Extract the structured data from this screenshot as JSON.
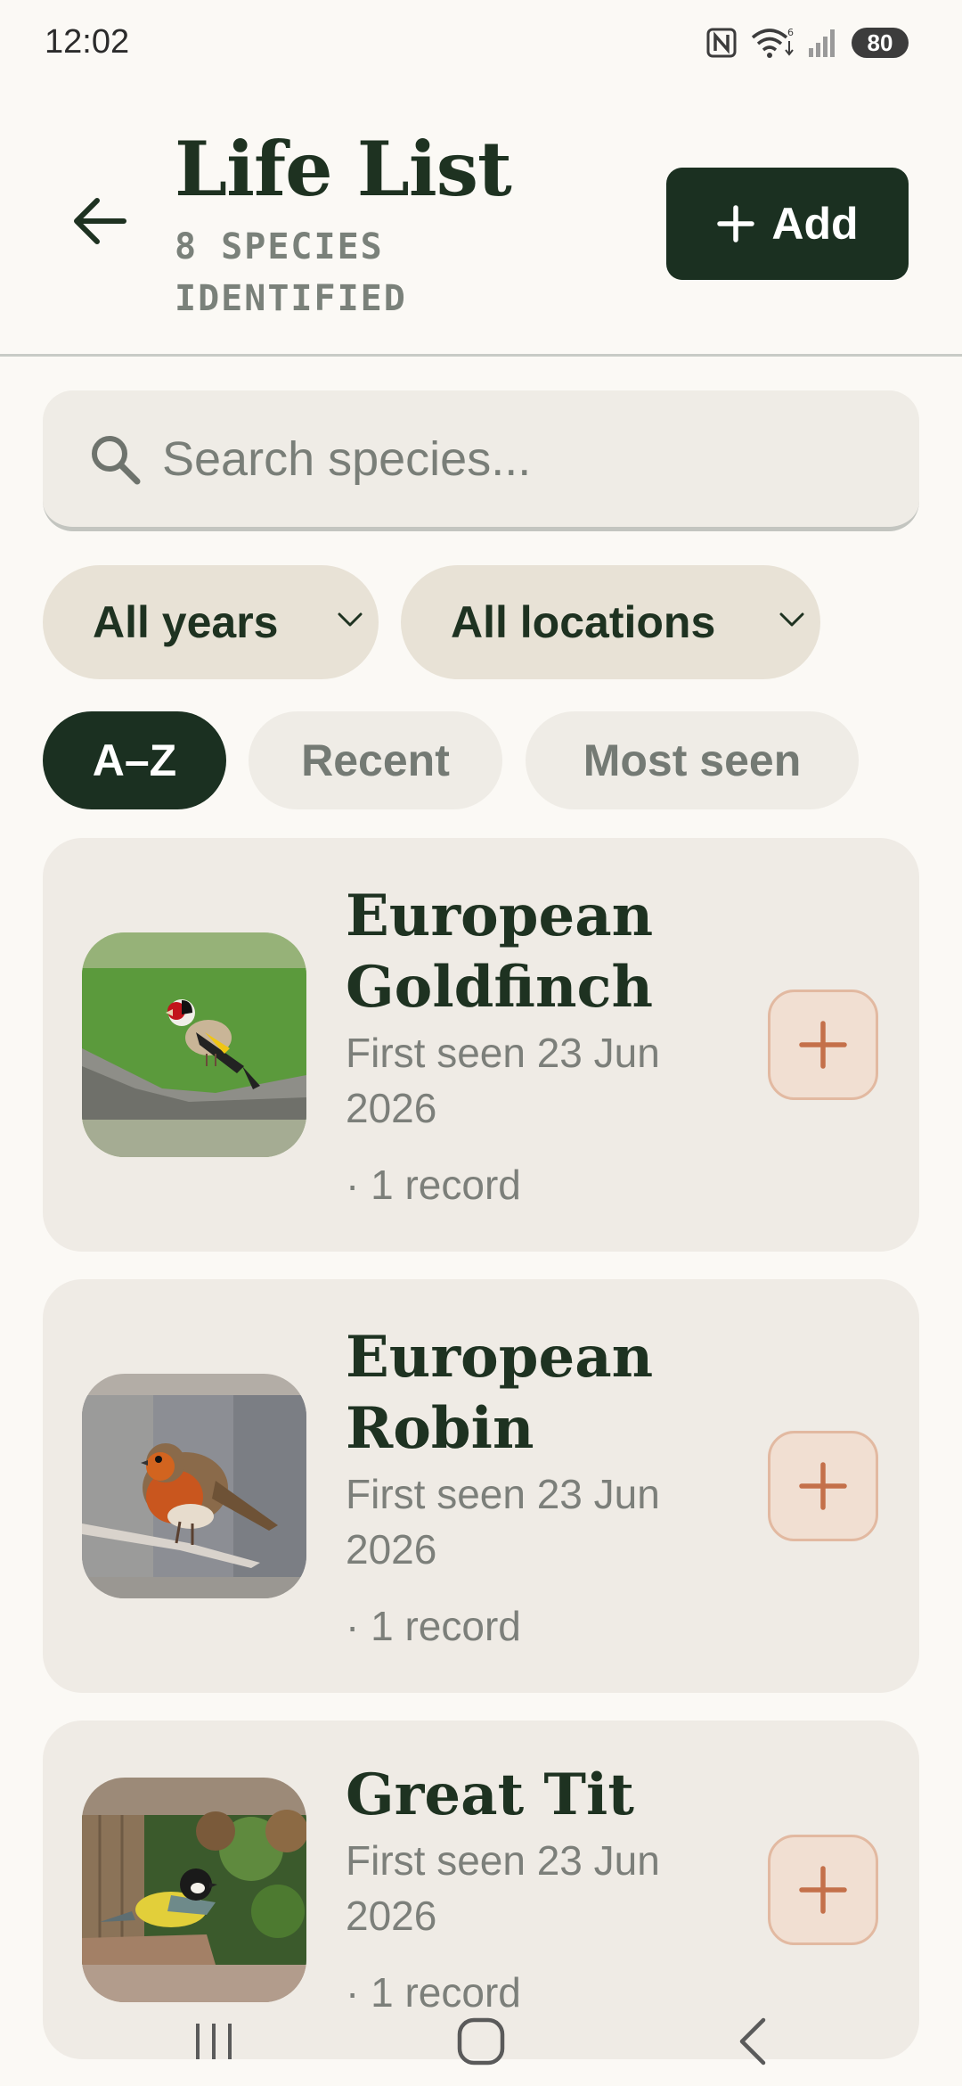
{
  "status_bar": {
    "time": "12:02",
    "battery": "80",
    "icons": [
      "nfc-icon",
      "wifi-icon",
      "signal-icon",
      "battery-icon"
    ]
  },
  "header": {
    "title": "Life List",
    "subtitle": "8 SPECIES IDENTIFIED",
    "add_label": "Add"
  },
  "search": {
    "placeholder": "Search species..."
  },
  "filters": {
    "years": "All years",
    "locations": "All locations"
  },
  "sort": {
    "options": [
      "A–Z",
      "Recent",
      "Most seen"
    ],
    "active": "A–Z"
  },
  "species": [
    {
      "name": "European Goldfinch",
      "first_seen": "First seen 23 Jun 2026",
      "records": "· 1 record"
    },
    {
      "name": "European Robin",
      "first_seen": "First seen 23 Jun 2026",
      "records": "· 1 record"
    },
    {
      "name": "Great Tit",
      "first_seen": "First seen 23 Jun 2026",
      "records": "· 1 record"
    }
  ],
  "colors": {
    "background": "#FBF9F5",
    "primary": "#1B3021",
    "card": "#EFEBE5",
    "chip": "#E8E2D6",
    "accent": "#C4704A",
    "muted_text": "#7C7F7A"
  }
}
